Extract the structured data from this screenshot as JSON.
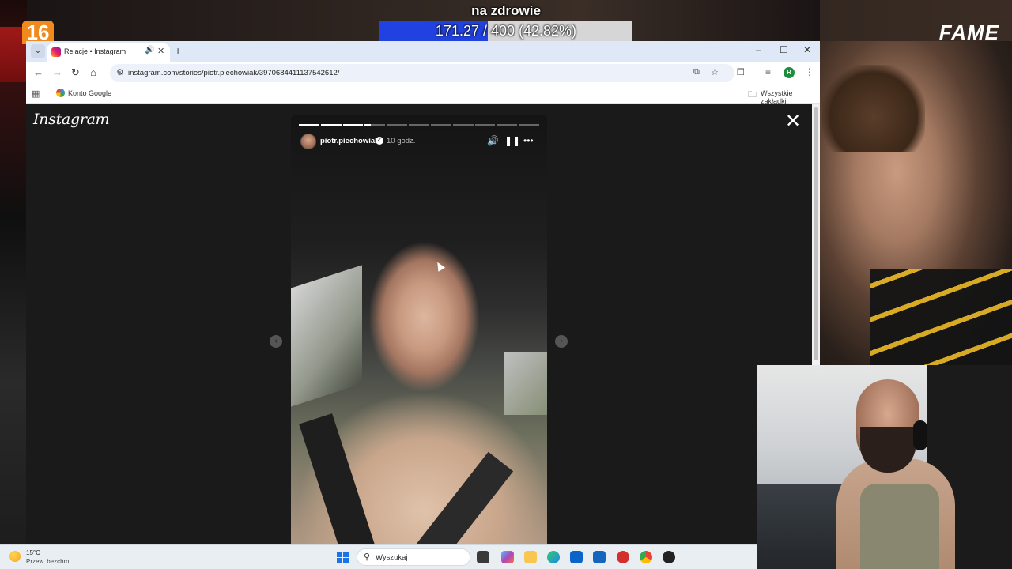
{
  "overlay": {
    "goal_title": "na zdrowie",
    "goal_text": "171.27 / 400 (42.82%)",
    "goal_fraction": 0.4282,
    "goal_fill_color": "#2142e0",
    "channel_logo": "FAME",
    "badge": "16"
  },
  "browser": {
    "tab": {
      "title": "Relacje • Instagram",
      "favicon": "instagram-icon",
      "audio_icon": "speaker-icon",
      "close": "✕"
    },
    "new_tab": "+",
    "window_controls": [
      "–",
      "☐",
      "✕"
    ],
    "url": "instagram.com/stories/piotr.piechowiak/3970684411137542612/",
    "profile_initial": "R",
    "profile_color": "#1e8e3e",
    "bookmarks": {
      "item_label": "Konto Google",
      "all_bookmarks": "Wszystkie zakładki"
    }
  },
  "instagram": {
    "logo": "Instagram",
    "close": "✕",
    "story": {
      "username": "piotr.piechowiak",
      "time": "10 godz.",
      "verified": true,
      "segments_total": 11,
      "segments_done": 3,
      "current_segment_fraction": 0.3,
      "controls": [
        "volume-icon",
        "pause-icon",
        "more-icon"
      ]
    },
    "nav": {
      "prev": "‹",
      "next": "›"
    }
  },
  "taskbar": {
    "weather_temp": "15°C",
    "weather_desc": "Przew. bezchm.",
    "search_placeholder": "Wyszukaj",
    "apps": [
      "task-view-icon",
      "copilot-icon",
      "file-explorer-icon",
      "edge-icon",
      "outlook-icon",
      "store-icon",
      "app-red-icon",
      "chrome-icon",
      "obs-icon"
    ]
  }
}
